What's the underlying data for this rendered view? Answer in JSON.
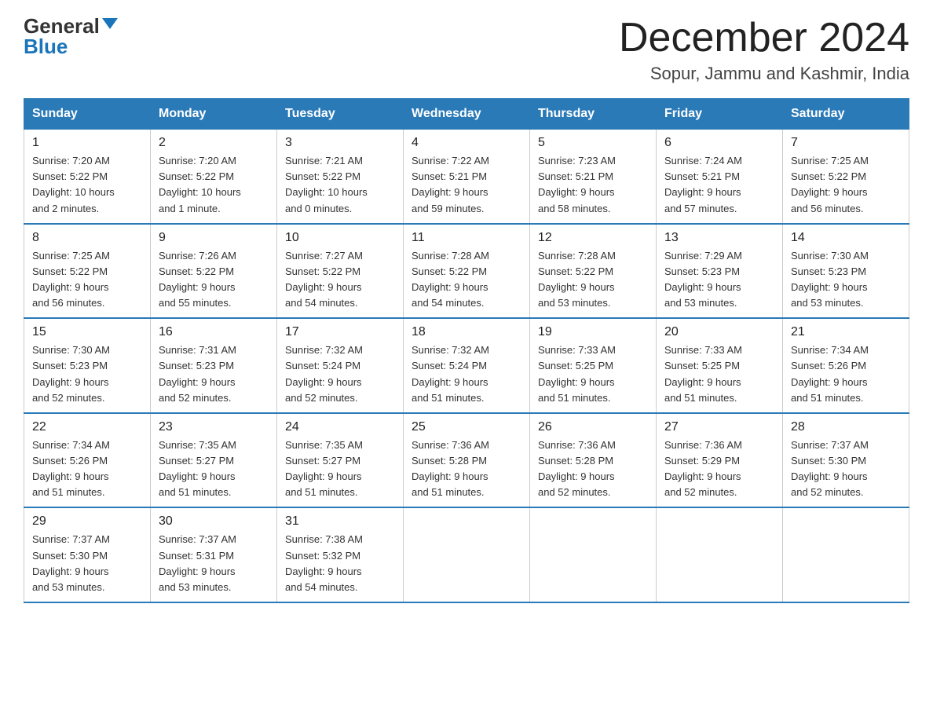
{
  "logo": {
    "general": "General",
    "blue": "Blue"
  },
  "title": "December 2024",
  "subtitle": "Sopur, Jammu and Kashmir, India",
  "days_of_week": [
    "Sunday",
    "Monday",
    "Tuesday",
    "Wednesday",
    "Thursday",
    "Friday",
    "Saturday"
  ],
  "weeks": [
    [
      {
        "day": "1",
        "info": "Sunrise: 7:20 AM\nSunset: 5:22 PM\nDaylight: 10 hours\nand 2 minutes."
      },
      {
        "day": "2",
        "info": "Sunrise: 7:20 AM\nSunset: 5:22 PM\nDaylight: 10 hours\nand 1 minute."
      },
      {
        "day": "3",
        "info": "Sunrise: 7:21 AM\nSunset: 5:22 PM\nDaylight: 10 hours\nand 0 minutes."
      },
      {
        "day": "4",
        "info": "Sunrise: 7:22 AM\nSunset: 5:21 PM\nDaylight: 9 hours\nand 59 minutes."
      },
      {
        "day": "5",
        "info": "Sunrise: 7:23 AM\nSunset: 5:21 PM\nDaylight: 9 hours\nand 58 minutes."
      },
      {
        "day": "6",
        "info": "Sunrise: 7:24 AM\nSunset: 5:21 PM\nDaylight: 9 hours\nand 57 minutes."
      },
      {
        "day": "7",
        "info": "Sunrise: 7:25 AM\nSunset: 5:22 PM\nDaylight: 9 hours\nand 56 minutes."
      }
    ],
    [
      {
        "day": "8",
        "info": "Sunrise: 7:25 AM\nSunset: 5:22 PM\nDaylight: 9 hours\nand 56 minutes."
      },
      {
        "day": "9",
        "info": "Sunrise: 7:26 AM\nSunset: 5:22 PM\nDaylight: 9 hours\nand 55 minutes."
      },
      {
        "day": "10",
        "info": "Sunrise: 7:27 AM\nSunset: 5:22 PM\nDaylight: 9 hours\nand 54 minutes."
      },
      {
        "day": "11",
        "info": "Sunrise: 7:28 AM\nSunset: 5:22 PM\nDaylight: 9 hours\nand 54 minutes."
      },
      {
        "day": "12",
        "info": "Sunrise: 7:28 AM\nSunset: 5:22 PM\nDaylight: 9 hours\nand 53 minutes."
      },
      {
        "day": "13",
        "info": "Sunrise: 7:29 AM\nSunset: 5:23 PM\nDaylight: 9 hours\nand 53 minutes."
      },
      {
        "day": "14",
        "info": "Sunrise: 7:30 AM\nSunset: 5:23 PM\nDaylight: 9 hours\nand 53 minutes."
      }
    ],
    [
      {
        "day": "15",
        "info": "Sunrise: 7:30 AM\nSunset: 5:23 PM\nDaylight: 9 hours\nand 52 minutes."
      },
      {
        "day": "16",
        "info": "Sunrise: 7:31 AM\nSunset: 5:23 PM\nDaylight: 9 hours\nand 52 minutes."
      },
      {
        "day": "17",
        "info": "Sunrise: 7:32 AM\nSunset: 5:24 PM\nDaylight: 9 hours\nand 52 minutes."
      },
      {
        "day": "18",
        "info": "Sunrise: 7:32 AM\nSunset: 5:24 PM\nDaylight: 9 hours\nand 51 minutes."
      },
      {
        "day": "19",
        "info": "Sunrise: 7:33 AM\nSunset: 5:25 PM\nDaylight: 9 hours\nand 51 minutes."
      },
      {
        "day": "20",
        "info": "Sunrise: 7:33 AM\nSunset: 5:25 PM\nDaylight: 9 hours\nand 51 minutes."
      },
      {
        "day": "21",
        "info": "Sunrise: 7:34 AM\nSunset: 5:26 PM\nDaylight: 9 hours\nand 51 minutes."
      }
    ],
    [
      {
        "day": "22",
        "info": "Sunrise: 7:34 AM\nSunset: 5:26 PM\nDaylight: 9 hours\nand 51 minutes."
      },
      {
        "day": "23",
        "info": "Sunrise: 7:35 AM\nSunset: 5:27 PM\nDaylight: 9 hours\nand 51 minutes."
      },
      {
        "day": "24",
        "info": "Sunrise: 7:35 AM\nSunset: 5:27 PM\nDaylight: 9 hours\nand 51 minutes."
      },
      {
        "day": "25",
        "info": "Sunrise: 7:36 AM\nSunset: 5:28 PM\nDaylight: 9 hours\nand 51 minutes."
      },
      {
        "day": "26",
        "info": "Sunrise: 7:36 AM\nSunset: 5:28 PM\nDaylight: 9 hours\nand 52 minutes."
      },
      {
        "day": "27",
        "info": "Sunrise: 7:36 AM\nSunset: 5:29 PM\nDaylight: 9 hours\nand 52 minutes."
      },
      {
        "day": "28",
        "info": "Sunrise: 7:37 AM\nSunset: 5:30 PM\nDaylight: 9 hours\nand 52 minutes."
      }
    ],
    [
      {
        "day": "29",
        "info": "Sunrise: 7:37 AM\nSunset: 5:30 PM\nDaylight: 9 hours\nand 53 minutes."
      },
      {
        "day": "30",
        "info": "Sunrise: 7:37 AM\nSunset: 5:31 PM\nDaylight: 9 hours\nand 53 minutes."
      },
      {
        "day": "31",
        "info": "Sunrise: 7:38 AM\nSunset: 5:32 PM\nDaylight: 9 hours\nand 54 minutes."
      },
      {
        "day": "",
        "info": ""
      },
      {
        "day": "",
        "info": ""
      },
      {
        "day": "",
        "info": ""
      },
      {
        "day": "",
        "info": ""
      }
    ]
  ]
}
